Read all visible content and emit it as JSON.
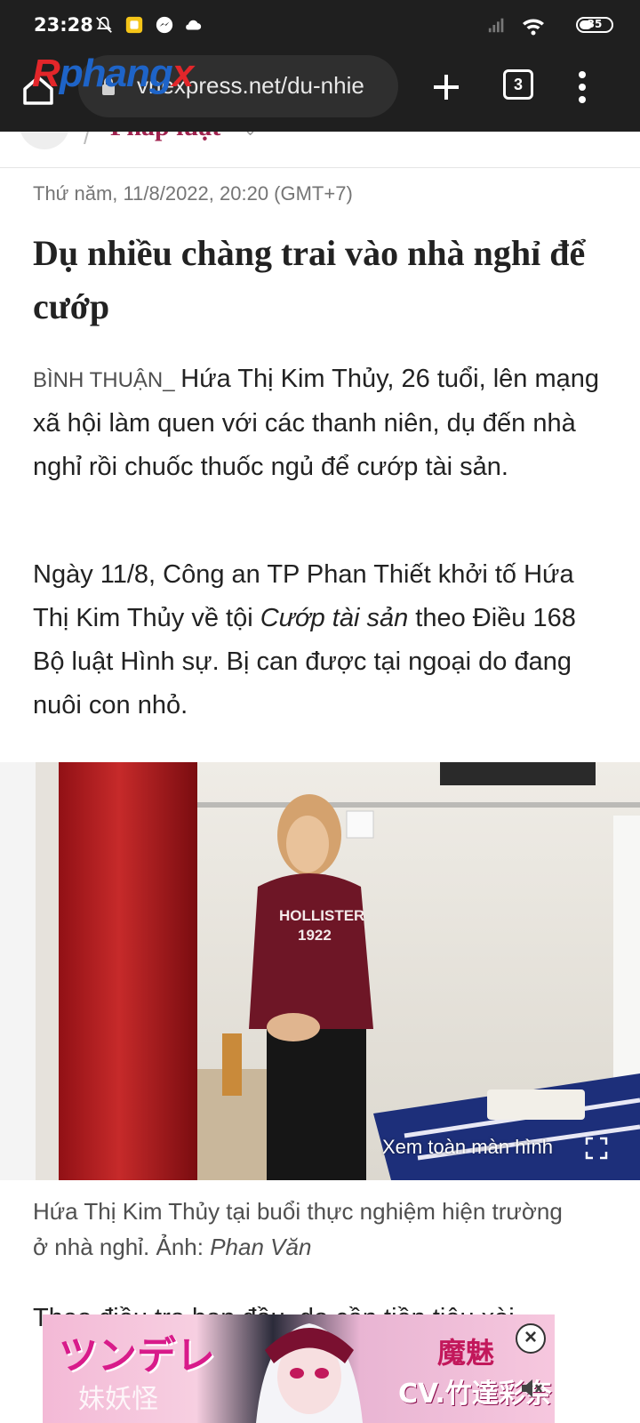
{
  "status_bar": {
    "time": "23:28",
    "battery": "35"
  },
  "browser": {
    "url": "vnexpress.net/du-nhie",
    "tab_count": "3",
    "watermark": {
      "part1": "R",
      "part2": "phang",
      "part3": "x"
    }
  },
  "category": {
    "label": "Pháp luật"
  },
  "article": {
    "date": "Thứ năm, 11/8/2022, 20:20 (GMT+7)",
    "title": "Dụ nhiều chàng trai vào nhà nghỉ để cướp",
    "location": "BÌNH THUẬN",
    "lead": "Hứa Thị Kim Thủy, 26 tuổi, lên mạng xã hội làm quen với các thanh niên, dụ đến nhà nghỉ rồi chuốc thuốc ngủ để cướp tài sản.",
    "p2_before": "Ngày 11/8, Công an TP Phan Thiết khởi tố Hứa Thị Kim Thủy về tội ",
    "p2_italic": "Cướp tài sản",
    "p2_after": " theo Điều 168 Bộ luật Hình sự. Bị can được tại ngoại do đang nuôi con nhỏ.",
    "photo_sweatshirt": [
      "HOLLISTER",
      "1922"
    ],
    "fullscreen_label": "Xem toàn màn hình",
    "caption_text": "Hứa Thị Kim Thủy tại buổi thực nghiệm hiện trường ở nhà nghỉ. Ảnh: ",
    "caption_credit": "Phan Văn",
    "p3_partial": "Theo điều tra ban đầu, do cần tiền tiêu xài,"
  },
  "ad": {
    "text_left": "ツンデレ",
    "text_left2": "妹妖怪",
    "text_right": "魔魅",
    "text_right2": "CV.竹達彩奈"
  },
  "colors": {
    "accent": "#9f224e",
    "toolbar": "#1f1f1f"
  }
}
